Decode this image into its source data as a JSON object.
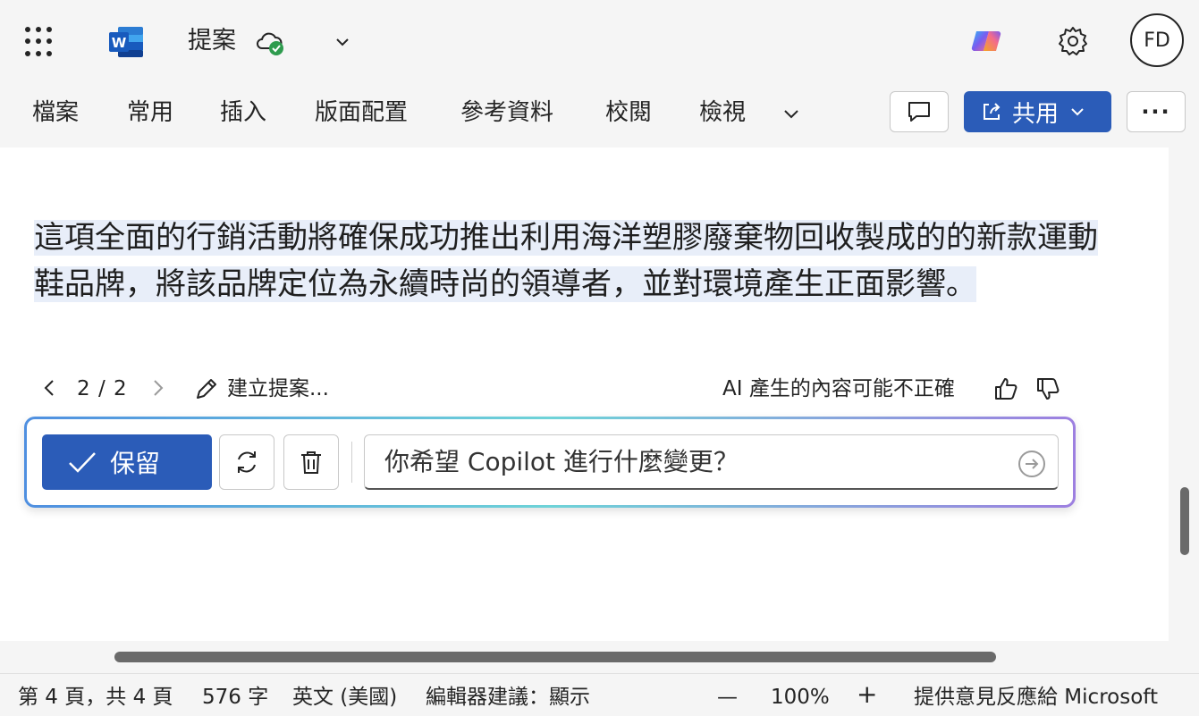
{
  "app": {
    "doc_title": "提案",
    "avatar_initials": "FD"
  },
  "ribbon": {
    "tabs": [
      "檔案",
      "常用",
      "插入",
      "版面配置",
      "參考資料",
      "校閱",
      "檢視"
    ],
    "share_label": "共用",
    "more_label": "···"
  },
  "document": {
    "paragraph": "這項全面的行銷活動將確保成功推出利用海洋塑膠廢棄物回收製成的的新款運動鞋品牌，將該品牌定位為永續時尚的領導者，並對環境產生正面影響。"
  },
  "suggestion": {
    "page_count": "2 / 2",
    "create_label": "建立提案...",
    "ai_note": "AI 產生的內容可能不正確"
  },
  "copilot_bar": {
    "keep_label": "保留",
    "prompt_placeholder": "你希望 Copilot 進行什麼變更？"
  },
  "statusbar": {
    "page_info": "第 4 頁，共 4 頁",
    "word_count": "576 字",
    "language": "英文 (美國)",
    "editor": "編輯器建議：顯示",
    "zoom_out": "—",
    "zoom": "100%",
    "zoom_in": "+",
    "feedback": "提供意見反應給 Microsoft"
  },
  "colors": {
    "accent": "#2b5cb8",
    "highlight": "#e8eef9"
  }
}
